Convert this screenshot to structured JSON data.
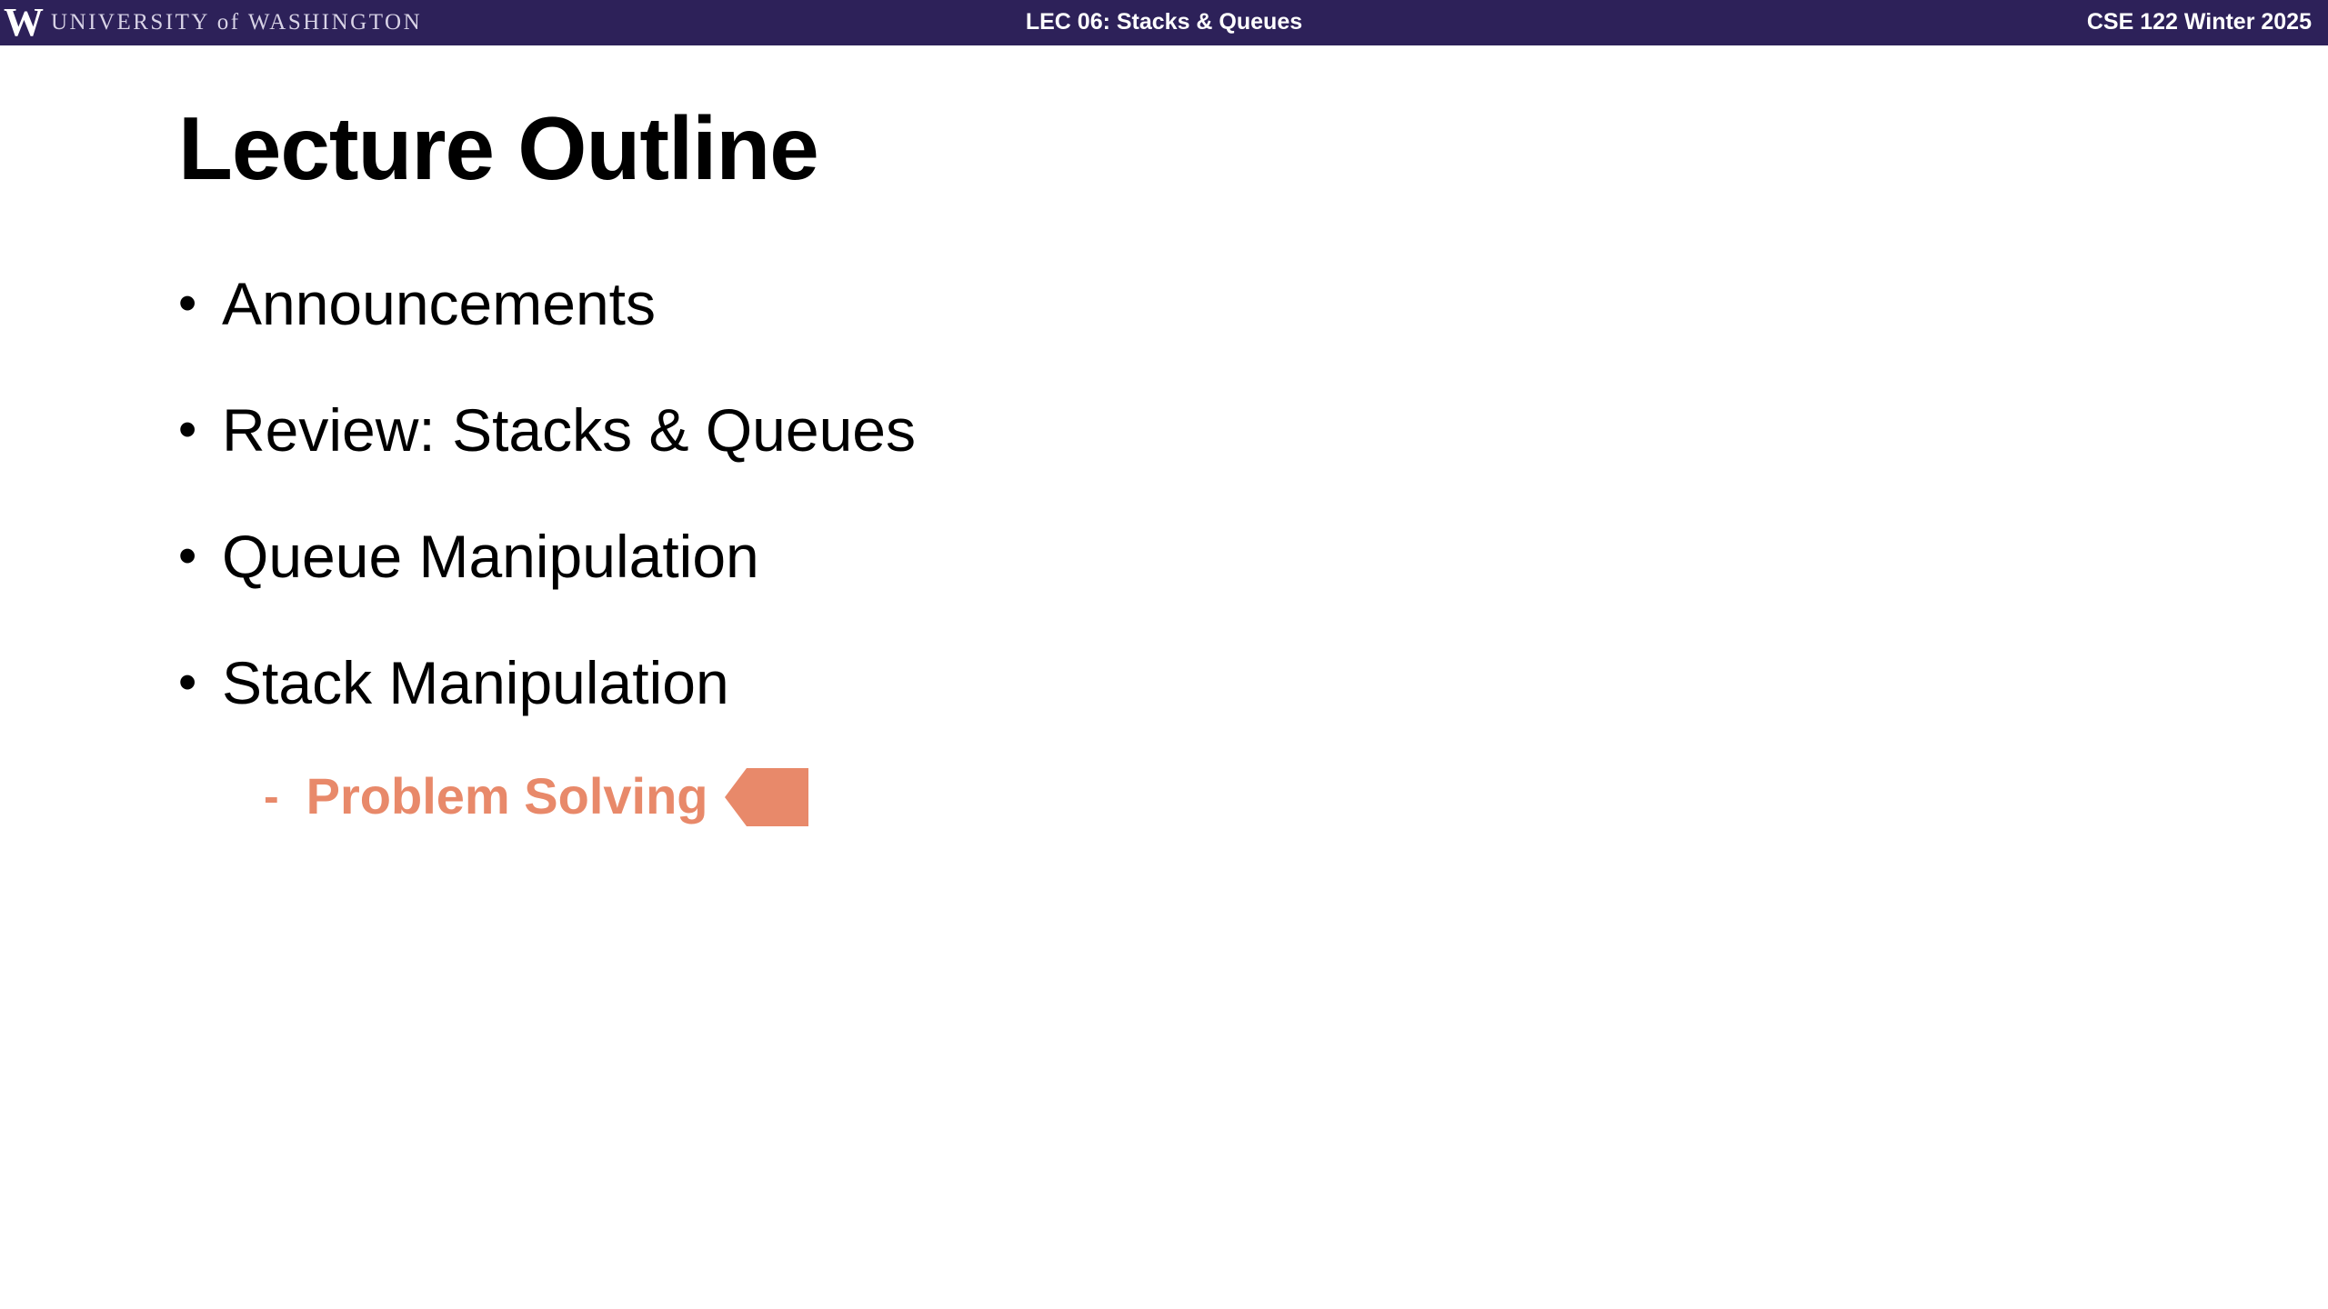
{
  "header": {
    "logo_letter": "W",
    "university_name": "UNIVERSITY of WASHINGTON",
    "lecture_title": "LEC 06: Stacks & Queues",
    "course": "CSE 122 Winter 2025"
  },
  "slide": {
    "title": "Lecture Outline",
    "items": [
      {
        "label": "Announcements"
      },
      {
        "label": "Review: Stacks & Queues"
      },
      {
        "label": "Queue Manipulation"
      },
      {
        "label": "Stack Manipulation"
      }
    ],
    "sub_item": {
      "dash": "-",
      "label": "Problem Solving"
    },
    "bullet_symbol": "•"
  },
  "colors": {
    "banner": "#2d2159",
    "accent": "#e8896a",
    "text": "#000000",
    "background": "#ffffff"
  },
  "icons": {
    "current_section_marker": "left-pointing pentagon arrow"
  }
}
